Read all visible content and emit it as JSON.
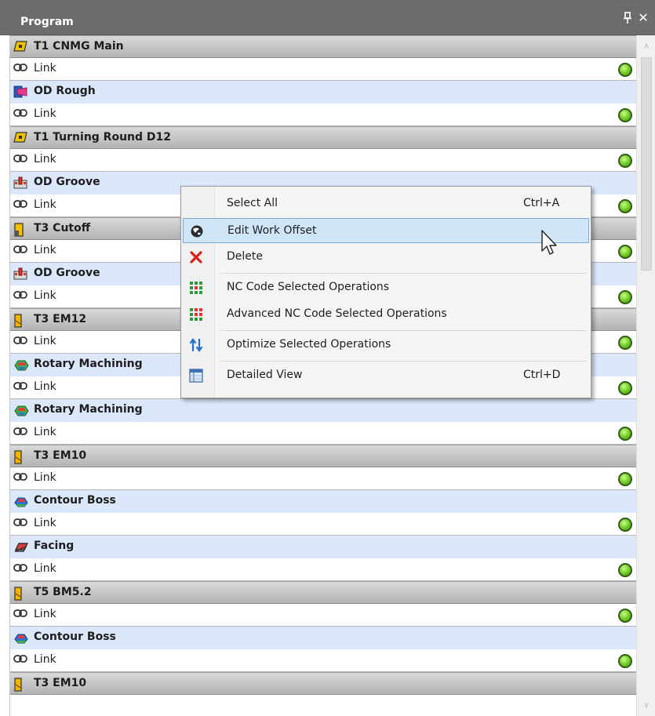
{
  "panel": {
    "title": "Program",
    "pin_glyph": "📌",
    "close_glyph": "✕"
  },
  "rows": [
    {
      "kind": "tool",
      "icon": "insert-tool-icon",
      "label": "T1 CNMG Main"
    },
    {
      "kind": "link",
      "icon": "link-icon",
      "label": "Link",
      "status": "green"
    },
    {
      "kind": "op",
      "icon": "rough-operation-icon",
      "label": "OD Rough"
    },
    {
      "kind": "link",
      "icon": "link-icon",
      "label": "Link",
      "status": "green"
    },
    {
      "kind": "tool",
      "icon": "insert-tool-icon",
      "label": "T1 Turning Round D12"
    },
    {
      "kind": "link",
      "icon": "link-icon",
      "label": "Link",
      "status": "green"
    },
    {
      "kind": "op",
      "icon": "groove-operation-icon",
      "label": "OD Groove"
    },
    {
      "kind": "link",
      "icon": "link-icon",
      "label": "Link",
      "status": "green"
    },
    {
      "kind": "tool",
      "icon": "cutoff-tool-icon",
      "label": "T3 Cutoff"
    },
    {
      "kind": "link",
      "icon": "link-icon",
      "label": "Link",
      "status": "green"
    },
    {
      "kind": "op",
      "icon": "groove-operation-icon",
      "label": "OD Groove"
    },
    {
      "kind": "link",
      "icon": "link-icon",
      "label": "Link",
      "status": "green"
    },
    {
      "kind": "tool",
      "icon": "endmill-tool-icon",
      "label": "T3 EM12"
    },
    {
      "kind": "link",
      "icon": "link-icon",
      "label": "Link",
      "status": "green"
    },
    {
      "kind": "op",
      "icon": "rotary-machining-icon",
      "label": "Rotary Machining"
    },
    {
      "kind": "link",
      "icon": "link-icon",
      "label": "Link",
      "status": "green"
    },
    {
      "kind": "op",
      "icon": "rotary-machining-icon",
      "label": "Rotary Machining"
    },
    {
      "kind": "link",
      "icon": "link-icon",
      "label": "Link",
      "status": "green"
    },
    {
      "kind": "tool",
      "icon": "endmill-tool-icon",
      "label": "T3 EM10"
    },
    {
      "kind": "link",
      "icon": "link-icon",
      "label": "Link",
      "status": "green"
    },
    {
      "kind": "op",
      "icon": "contour-boss-icon",
      "label": "Contour Boss"
    },
    {
      "kind": "link",
      "icon": "link-icon",
      "label": "Link",
      "status": "green"
    },
    {
      "kind": "op",
      "icon": "facing-icon",
      "label": "Facing"
    },
    {
      "kind": "link",
      "icon": "link-icon",
      "label": "Link",
      "status": "green"
    },
    {
      "kind": "tool",
      "icon": "endmill-tool-icon",
      "label": "T5 BM5.2"
    },
    {
      "kind": "link",
      "icon": "link-icon",
      "label": "Link",
      "status": "green"
    },
    {
      "kind": "op",
      "icon": "contour-boss-icon",
      "label": "Contour Boss"
    },
    {
      "kind": "link",
      "icon": "link-icon",
      "label": "Link",
      "status": "green"
    },
    {
      "kind": "tool",
      "icon": "endmill-tool-icon",
      "label": "T3 EM10"
    }
  ],
  "context_menu": {
    "items": [
      {
        "label": "Select All",
        "shortcut": "Ctrl+A",
        "icon": "",
        "name": "select-all"
      },
      {
        "label": "Edit Work Offset",
        "shortcut": "",
        "icon": "globe-icon",
        "name": "edit-work-offset",
        "highlighted": true
      },
      {
        "label": "Delete",
        "shortcut": "",
        "icon": "delete-x-icon",
        "name": "delete"
      },
      {
        "separator": true
      },
      {
        "label": "NC Code Selected Operations",
        "shortcut": "",
        "icon": "nc-code-icon",
        "name": "nc-code-selected"
      },
      {
        "label": "Advanced NC Code Selected Operations",
        "shortcut": "",
        "icon": "advanced-nc-code-icon",
        "name": "advanced-nc-code-selected"
      },
      {
        "separator": true
      },
      {
        "label": "Optimize Selected Operations",
        "shortcut": "",
        "icon": "optimize-arrows-icon",
        "name": "optimize-selected"
      },
      {
        "separator": true
      },
      {
        "label": "Detailed View",
        "shortcut": "Ctrl+D",
        "icon": "detailed-view-icon",
        "name": "detailed-view"
      }
    ]
  },
  "colors": {
    "titlebar": "#6c6c6c",
    "tool_row": "#c4c4c4",
    "operation_row": "#dbe8fb",
    "status_green": "#6cc624",
    "menu_highlight": "#cfe5f8"
  }
}
